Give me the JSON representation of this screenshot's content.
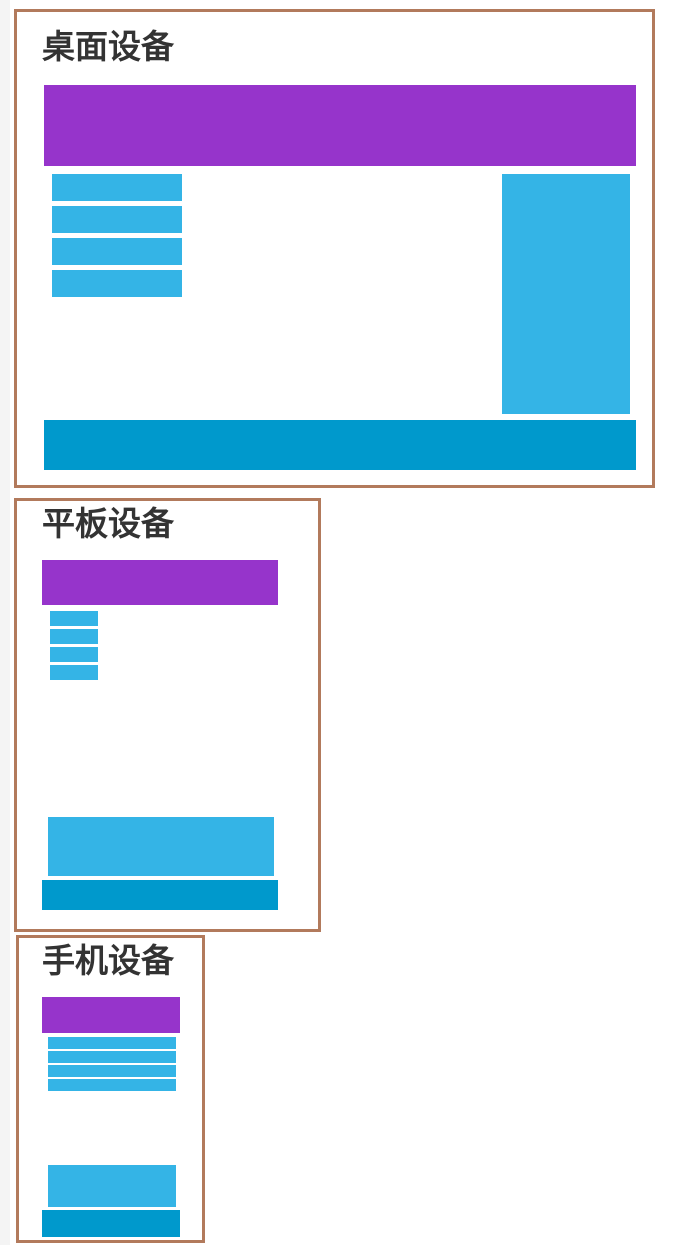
{
  "colors": {
    "frame_border": "#b27a5c",
    "header": "#9634cb",
    "light_block": "#34b4e6",
    "footer": "#0099cc",
    "title_text": "#333333"
  },
  "devices": [
    {
      "id": "desktop",
      "title": "桌面设备",
      "nav_item_count": 4
    },
    {
      "id": "tablet",
      "title": "平板设备",
      "nav_item_count": 4
    },
    {
      "id": "mobile",
      "title": "手机设备",
      "nav_item_count": 4
    }
  ]
}
